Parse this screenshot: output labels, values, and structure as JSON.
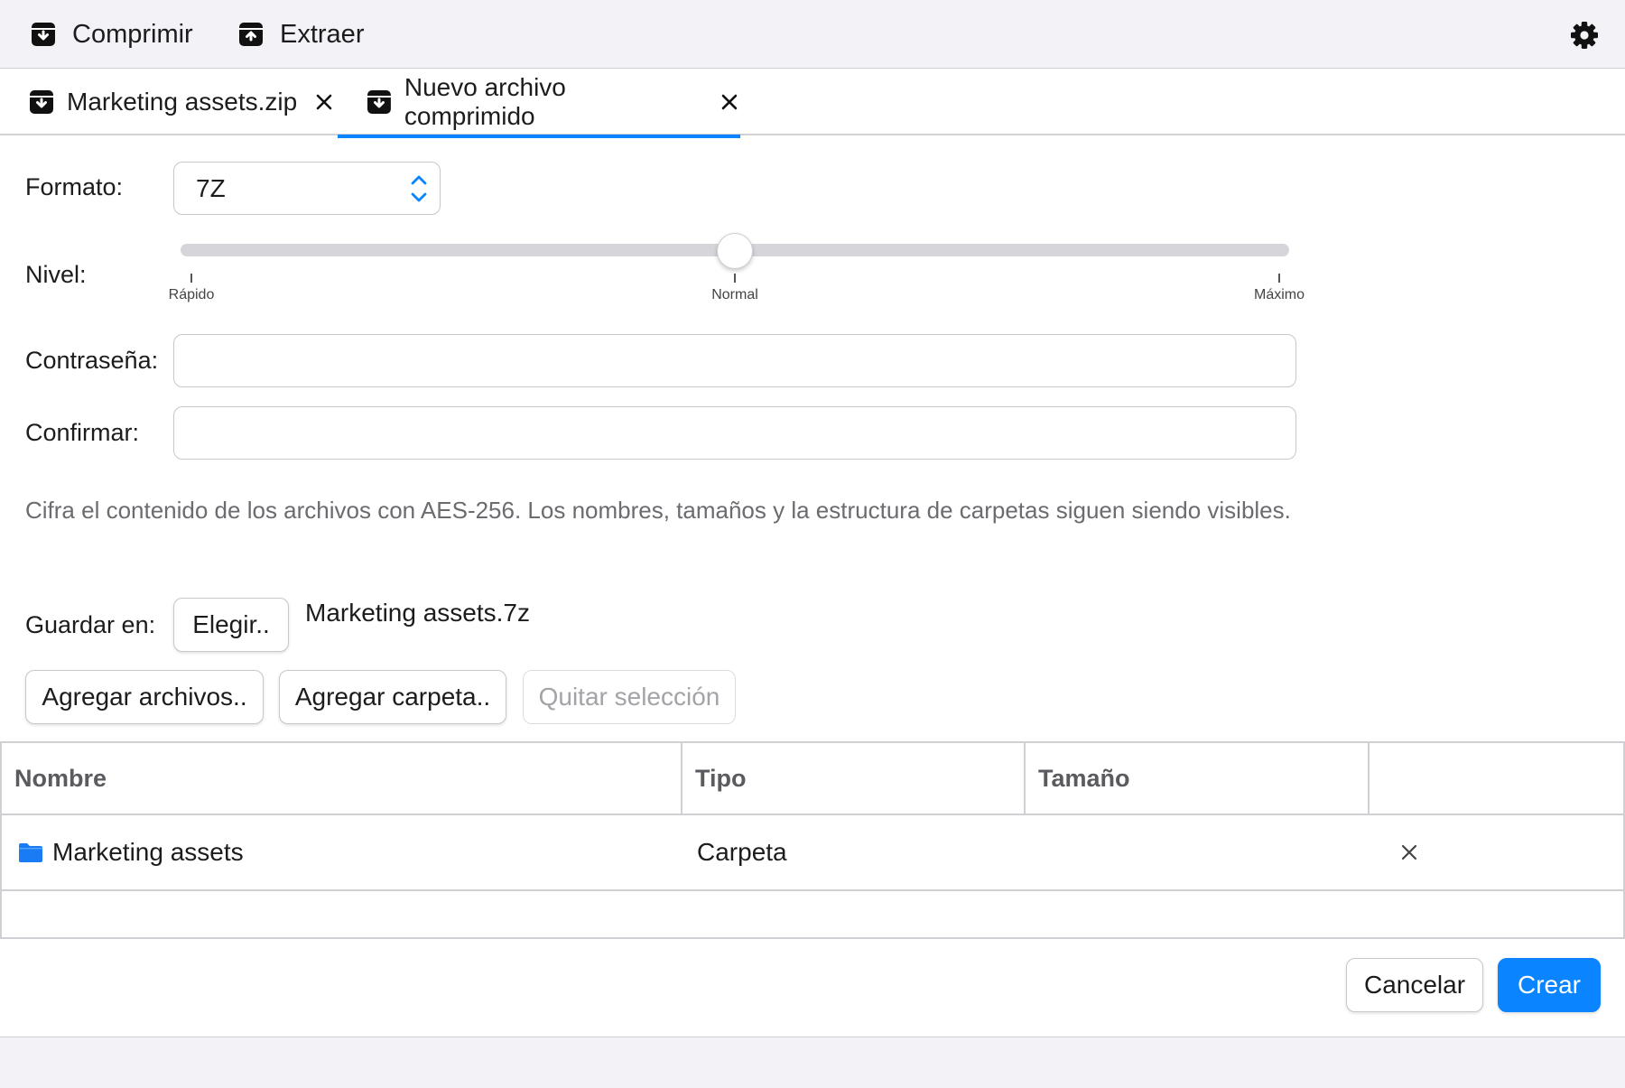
{
  "toolbar": {
    "compress_label": "Comprimir",
    "extract_label": "Extraer",
    "icons": {
      "compress": "archive-down-icon",
      "extract": "archive-up-icon",
      "settings": "gear-icon"
    }
  },
  "tabs": [
    {
      "label": "Marketing assets.zip",
      "active": false
    },
    {
      "label": "Nuevo archivo comprimido",
      "active": true
    }
  ],
  "form": {
    "format_label": "Formato:",
    "format_value": "7Z",
    "level_label": "Nivel:",
    "level": {
      "ticks": [
        "Rápido",
        "Normal",
        "Máximo"
      ],
      "value_fraction": 0.5
    },
    "password_label": "Contraseña:",
    "password_value": "",
    "confirm_label": "Confirmar:",
    "confirm_value": "",
    "hint": "Cifra el contenido de los archivos con AES-256. Los nombres, tamaños y la estructura de carpetas siguen siendo visibles.",
    "save_label": "Guardar en:",
    "choose_button": "Elegir..",
    "output_filename": "Marketing assets.7z"
  },
  "actions": {
    "add_files": "Agregar archivos..",
    "add_folder": "Agregar carpeta..",
    "remove_selection": "Quitar selección"
  },
  "table": {
    "columns": [
      "Nombre",
      "Tipo",
      "Tamaño",
      ""
    ],
    "rows": [
      {
        "name": "Marketing assets",
        "type": "Carpeta",
        "size": "",
        "icon": "folder-icon"
      }
    ]
  },
  "footer": {
    "cancel": "Cancelar",
    "create": "Crear"
  },
  "colors": {
    "accent": "#0a84ff",
    "toolbar_bg": "#f2f2f7",
    "border": "#c7c7cc",
    "hint_text": "#6b6b70"
  }
}
